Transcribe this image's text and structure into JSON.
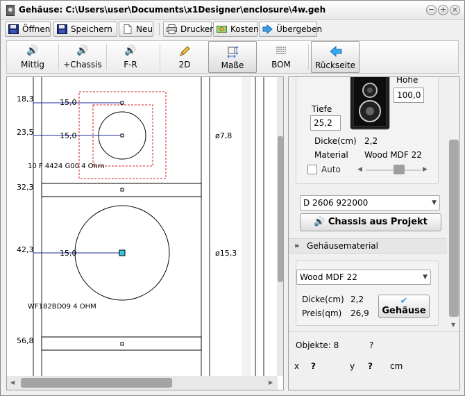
{
  "window": {
    "title": "Gehäuse: C:\\Users\\user\\Documents\\x1Designer\\enclosure\\4w.geh",
    "btn_minimize": "−",
    "btn_maximize": "+",
    "btn_close": "×"
  },
  "toolbar": {
    "open": "Öffnen",
    "save": "Speichern",
    "new": "Neu",
    "print": "Drucken",
    "cost": "Kosten",
    "transfer": "Übergeben"
  },
  "tools": [
    {
      "label": "Mittig",
      "icon": "speaker-icon"
    },
    {
      "label": "+Chassis",
      "icon": "speaker-icon"
    },
    {
      "label": "F-R",
      "icon": "speaker-icon"
    },
    {
      "label": "2D",
      "icon": "pencil-icon"
    },
    {
      "label": "Maße",
      "icon": "dimensions-icon"
    },
    {
      "label": "BOM",
      "icon": "list-icon"
    },
    {
      "label": "Rückseite",
      "icon": "arrow-left-icon"
    }
  ],
  "drawing": {
    "row_labels": [
      "18,3",
      "23,5",
      "32,3",
      "42,3",
      "56,8"
    ],
    "offset_labels": [
      "15,0",
      "15,0",
      "15,0"
    ],
    "diameter_labels": [
      "ø7,8",
      "ø15,3"
    ],
    "chassis1_name": "10 F 4424 G00  4 Ohm",
    "chassis2_name": "WF182BD09  4 OHM"
  },
  "properties": {
    "height_label": "Höhe",
    "height_value": "100,0",
    "depth_label": "Tiefe",
    "depth_value": "25,2",
    "thickness_label": "Dicke(cm)",
    "thickness_value": "2,2",
    "material_label": "Material",
    "material_value": "Wood MDF 22",
    "auto_label": "Auto",
    "chassis_combo": "D 2606 922000",
    "chassis_from_project": "Chassis aus Projekt"
  },
  "material_section": {
    "header": "Gehäusematerial",
    "material_combo": "Wood MDF 22",
    "thickness_label": "Dicke(cm)",
    "thickness_value": "2,2",
    "price_label": "Preis(qm)",
    "price_value": "26,9",
    "enclosure_button": "Gehäuse"
  },
  "status": {
    "objects_label": "Objekte: 8",
    "objects_extra": "?",
    "x_label": "x",
    "x_value": "?",
    "y_label": "y",
    "y_value": "?",
    "unit": "cm"
  },
  "colors": {
    "dim_line": "#1c2a9c",
    "cut_dashed": "#d32020",
    "accent_cyan": "#34c8e0"
  }
}
